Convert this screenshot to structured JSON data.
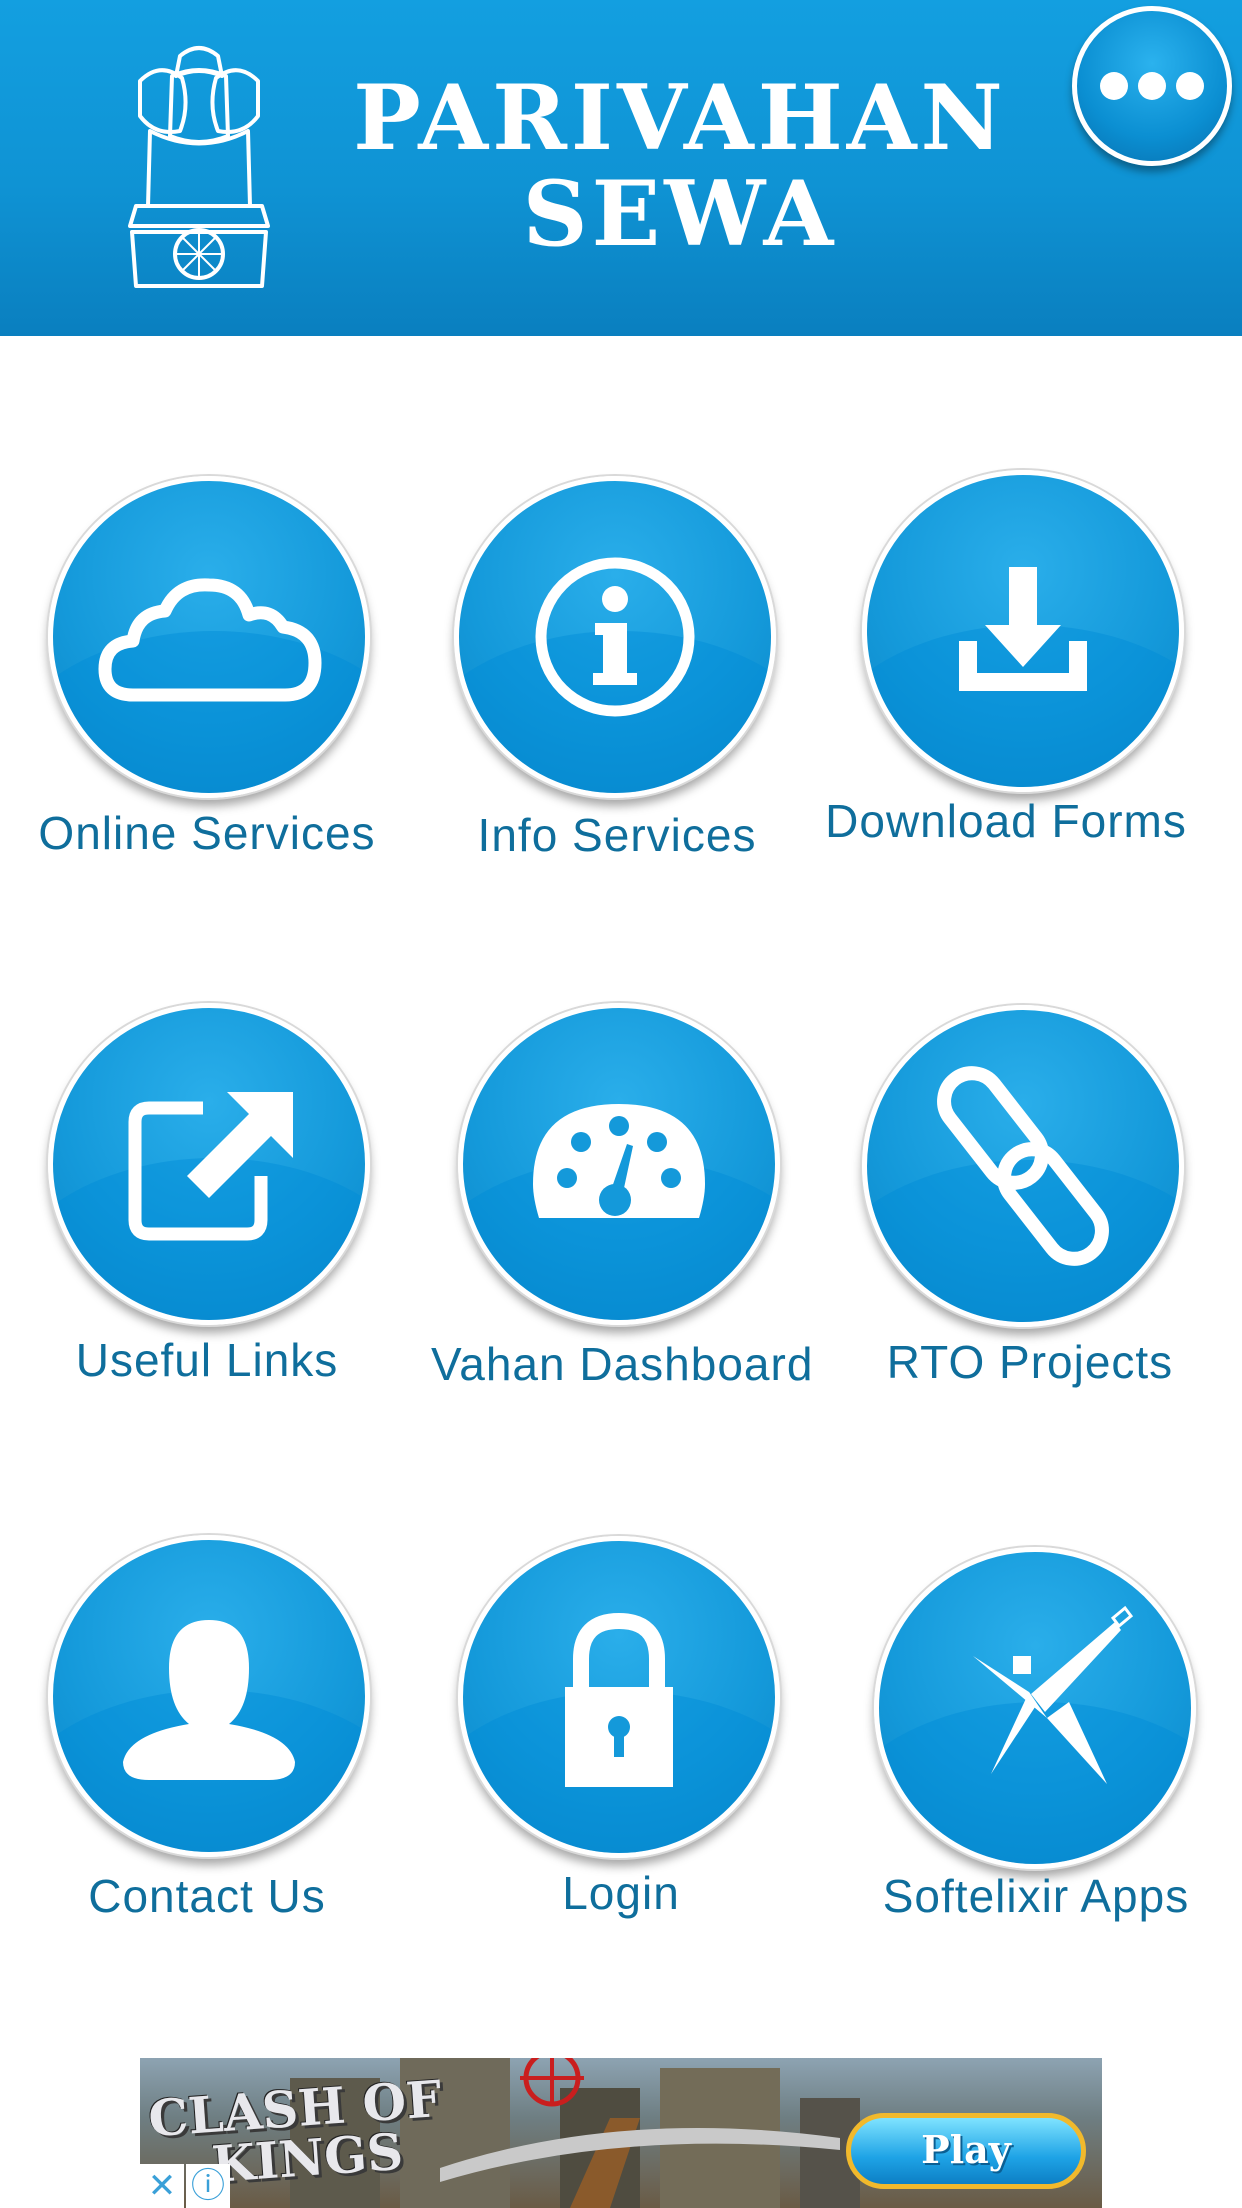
{
  "header": {
    "title_line1": "PARIVAHAN",
    "title_line2": "SEWA",
    "emblem": "national-emblem",
    "menu_icon": "more-dots-icon"
  },
  "colors": {
    "header_blue": "#0f93d4",
    "circle_blue": "#1499da",
    "label_text": "#0f6e9c",
    "background": "#ffffff"
  },
  "grid": {
    "items": [
      {
        "label": "Online Services",
        "icon": "cloud-icon"
      },
      {
        "label": "Info Services",
        "icon": "info-icon"
      },
      {
        "label": "Download Forms",
        "icon": "download-icon"
      },
      {
        "label": "Useful Links",
        "icon": "external-link-icon"
      },
      {
        "label": "Vahan Dashboard",
        "icon": "dashboard-gauge-icon"
      },
      {
        "label": "RTO Projects",
        "icon": "chain-link-icon"
      },
      {
        "label": "Contact Us",
        "icon": "user-icon"
      },
      {
        "label": "Login",
        "icon": "padlock-icon"
      },
      {
        "label": "Softelixir Apps",
        "icon": "softelixir-logo-icon"
      }
    ]
  },
  "ad": {
    "title_line1": "CLASH OF",
    "title_line2": "KINGS",
    "button_label": "Play",
    "close_glyph": "✕",
    "info_glyph": "ⓘ"
  }
}
